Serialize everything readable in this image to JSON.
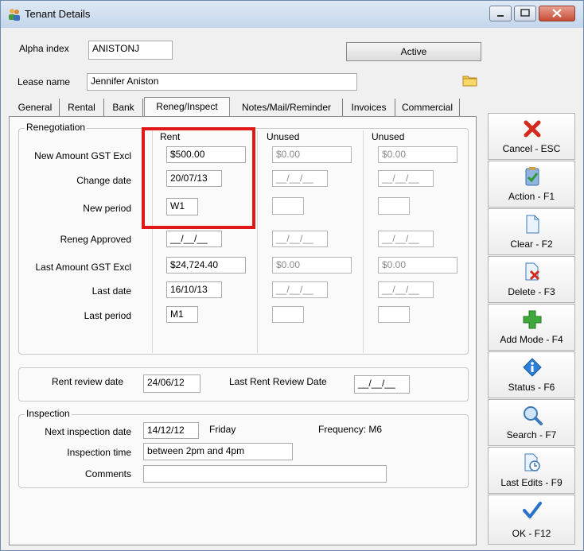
{
  "window": {
    "title": "Tenant Details"
  },
  "header": {
    "alpha_index_label": "Alpha index",
    "alpha_index_value": "ANISTONJ",
    "status_button": "Active",
    "lease_name_label": "Lease name",
    "lease_name_value": "Jennifer Aniston"
  },
  "tabs": [
    {
      "label": "General"
    },
    {
      "label": "Rental"
    },
    {
      "label": "Bank"
    },
    {
      "label": "Reneg/Inspect"
    },
    {
      "label": "Notes/Mail/Reminder"
    },
    {
      "label": "Invoices"
    },
    {
      "label": "Commercial"
    }
  ],
  "renegotiation": {
    "group_title": "Renegotiation",
    "columns": [
      "Rent",
      "Unused",
      "Unused"
    ],
    "rows": {
      "new_amount": {
        "label": "New Amount GST Excl",
        "values": [
          "$500.00",
          "$0.00",
          "$0.00"
        ]
      },
      "change_date": {
        "label": "Change date",
        "values": [
          "20/07/13",
          "__/__/__",
          "__/__/__"
        ]
      },
      "new_period": {
        "label": "New period",
        "values": [
          "W1",
          "",
          ""
        ]
      },
      "reneg_approved": {
        "label": "Reneg Approved",
        "values": [
          "__/__/__",
          "__/__/__",
          "__/__/__"
        ]
      },
      "last_amount": {
        "label": "Last Amount GST Excl",
        "values": [
          "$24,724.40",
          "$0.00",
          "$0.00"
        ]
      },
      "last_date": {
        "label": "Last date",
        "values": [
          "16/10/13",
          "__/__/__",
          "__/__/__"
        ]
      },
      "last_period": {
        "label": "Last period",
        "values": [
          "M1",
          "",
          ""
        ]
      }
    }
  },
  "review": {
    "rent_review_label": "Rent review date",
    "rent_review_value": "24/06/12",
    "last_rent_review_label": "Last Rent Review Date",
    "last_rent_review_value": "__/__/__"
  },
  "inspection": {
    "group_title": "Inspection",
    "next_date_label": "Next inspection date",
    "next_date_value": "14/12/12",
    "next_day": "Friday",
    "frequency": "Frequency: M6",
    "time_label": "Inspection time",
    "time_value": "between 2pm and 4pm",
    "comments_label": "Comments",
    "comments_value": ""
  },
  "sidebar": [
    {
      "label": "Cancel - ESC",
      "icon": "cancel-x-icon"
    },
    {
      "label": "Action - F1",
      "icon": "clipboard-check-icon"
    },
    {
      "label": "Clear - F2",
      "icon": "blank-page-icon"
    },
    {
      "label": "Delete - F3",
      "icon": "delete-page-icon"
    },
    {
      "label": "Add Mode - F4",
      "icon": "plus-icon"
    },
    {
      "label": "Status - F6",
      "icon": "info-icon"
    },
    {
      "label": "Search - F7",
      "icon": "magnifier-icon"
    },
    {
      "label": "Last Edits - F9",
      "icon": "clock-page-icon"
    },
    {
      "label": "OK - F12",
      "icon": "checkmark-icon"
    }
  ],
  "colors": {
    "highlight": "#e01818",
    "cancel_red": "#d42a1e",
    "add_green": "#3fa83a",
    "info_blue": "#2a7fd6"
  }
}
